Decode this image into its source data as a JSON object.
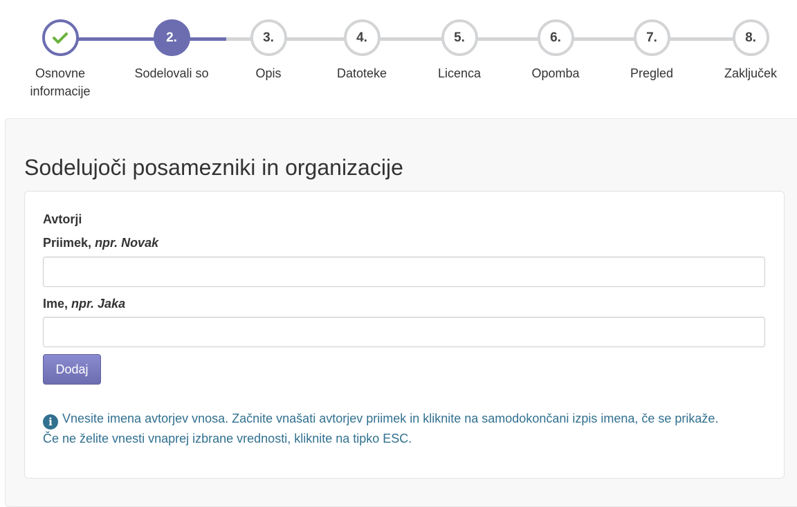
{
  "stepper": {
    "steps": [
      {
        "number": "",
        "label": "Osnovne informacije",
        "state": "done",
        "icon": "check-icon"
      },
      {
        "number": "2.",
        "label": "Sodelovali so",
        "state": "active"
      },
      {
        "number": "3.",
        "label": "Opis",
        "state": "pending"
      },
      {
        "number": "4.",
        "label": "Datoteke",
        "state": "pending"
      },
      {
        "number": "5.",
        "label": "Licenca",
        "state": "pending"
      },
      {
        "number": "6.",
        "label": "Opomba",
        "state": "pending"
      },
      {
        "number": "7.",
        "label": "Pregled",
        "state": "pending"
      },
      {
        "number": "8.",
        "label": "Zaključek",
        "state": "pending"
      }
    ],
    "accent_color": "#6c6db0",
    "done_check_color": "#6ab23d"
  },
  "section": {
    "title": "Sodelujoči posamezniki in organizacije"
  },
  "form": {
    "group_label": "Avtorji",
    "surname": {
      "label": "Priimek,",
      "example": "npr. Novak",
      "value": "",
      "placeholder": ""
    },
    "name": {
      "label": "Ime,",
      "example": "npr. Jaka",
      "value": "",
      "placeholder": ""
    },
    "add_button_label": "Dodaj"
  },
  "help": {
    "icon": "info-icon",
    "icon_glyph": "i",
    "line1": "Vnesite imena avtorjev vnosa. Začnite vnašati avtorjev priimek in kliknite na samodokončani izpis imena, če se prikaže.",
    "line2": "Če ne želite vnesti vnaprej izbrane vrednosti, kliknite na tipko ESC.",
    "color": "#31708f"
  }
}
